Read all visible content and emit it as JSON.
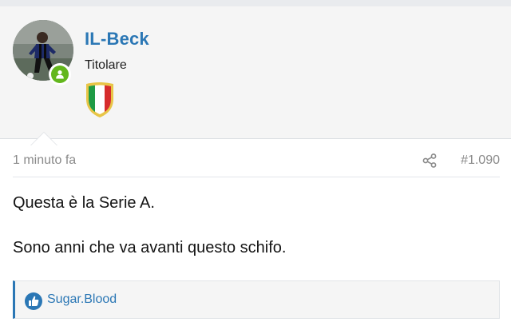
{
  "user": {
    "name": "IL-Beck",
    "title": "Titolare",
    "avatar_icon": "player-avatar",
    "online_icon": "user-online-icon",
    "badge_icon": "scudetto-icon"
  },
  "post": {
    "time": "1 minuto fa",
    "number": "#1.090",
    "share_icon": "share-icon",
    "paragraphs": [
      "Questa è la Serie A.",
      "Sono anni che va avanti questo schifo."
    ]
  },
  "reactions": {
    "icon": "like-icon",
    "users": "Sugar.Blood"
  },
  "colors": {
    "link": "#2b77b5",
    "online": "#63b71d",
    "panel_bg": "#f5f5f5"
  }
}
